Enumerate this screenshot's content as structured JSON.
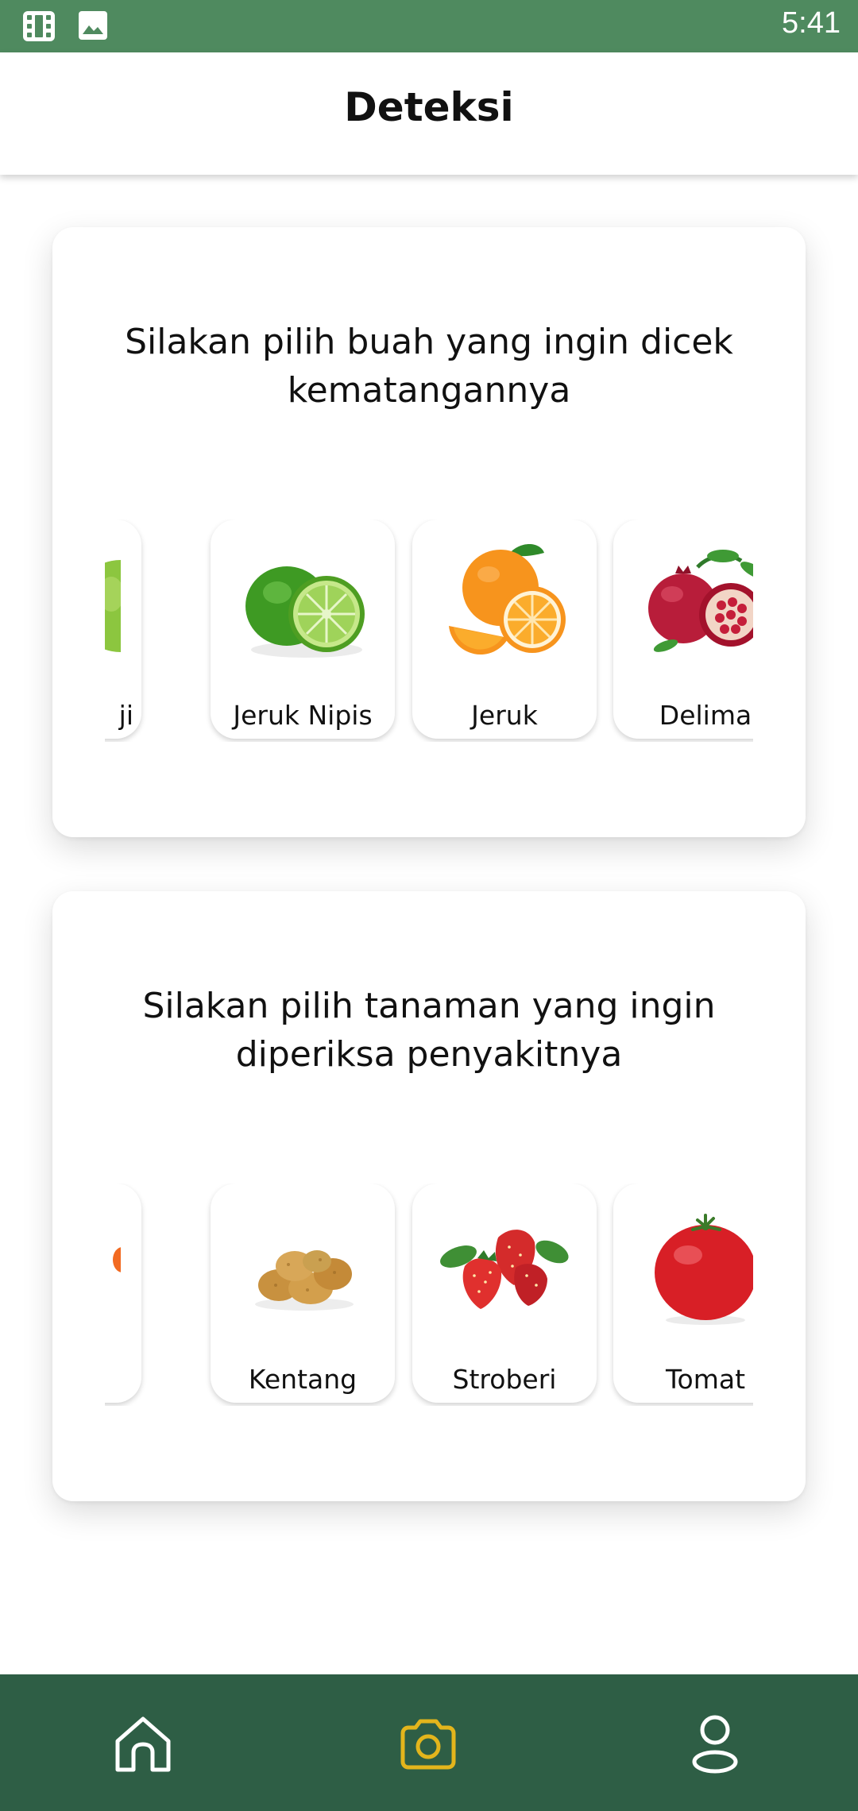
{
  "status_bar": {
    "time": "5:41",
    "icons": [
      "film-strip-icon",
      "image-icon"
    ]
  },
  "app_bar": {
    "title": "Deteksi"
  },
  "fruit_card": {
    "title": "Silakan pilih buah yang ingin dicek kematangannya",
    "items": [
      {
        "label": "Apel Hijau",
        "visible_label": "ji",
        "icon": "green-apple-image",
        "partial": true
      },
      {
        "label": "Jeruk Nipis",
        "icon": "lime-image"
      },
      {
        "label": "Jeruk",
        "icon": "orange-image"
      },
      {
        "label": "Delima",
        "icon": "pomegranate-image"
      }
    ]
  },
  "plant_card": {
    "title": "Silakan pilih tanaman yang ingin diperiksa penyakitnya",
    "items": [
      {
        "label": "",
        "visible_label": "",
        "icon": "orange-plant-image",
        "partial": true
      },
      {
        "label": "Kentang",
        "icon": "potato-image"
      },
      {
        "label": "Stroberi",
        "icon": "strawberry-image"
      },
      {
        "label": "Tomat",
        "icon": "tomato-image"
      }
    ]
  },
  "bottom_nav": {
    "items": [
      {
        "icon": "home-icon",
        "active": false
      },
      {
        "icon": "camera-icon",
        "active": true
      },
      {
        "icon": "profile-icon",
        "active": false
      }
    ],
    "colors": {
      "background": "#2e5e45",
      "active": "#e3b51c",
      "inactive": "#ffffff"
    }
  },
  "colors": {
    "status_bar": "#4f8a5f",
    "page_background": "#ffffff"
  }
}
